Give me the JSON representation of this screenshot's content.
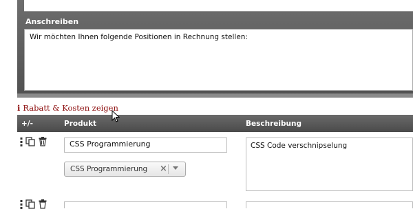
{
  "letter": {
    "section_label": "Anschreiben",
    "text": "Wir möchten Ihnen folgende Positionen in Rechnung stellen:"
  },
  "toggle": {
    "icon": "info-icon",
    "label": "Rabatt & Kosten zeigen"
  },
  "table": {
    "columns": [
      "+/-",
      "Produkt",
      "Beschreibung"
    ],
    "rows": [
      {
        "product_value": "CSS Programmierung",
        "select_value": "CSS Programmierung",
        "description": "CSS Code verschnipselung"
      },
      {
        "product_value": "",
        "description": ""
      }
    ]
  },
  "colors": {
    "header_bg": "#555555",
    "link": "#8b0a0a"
  }
}
